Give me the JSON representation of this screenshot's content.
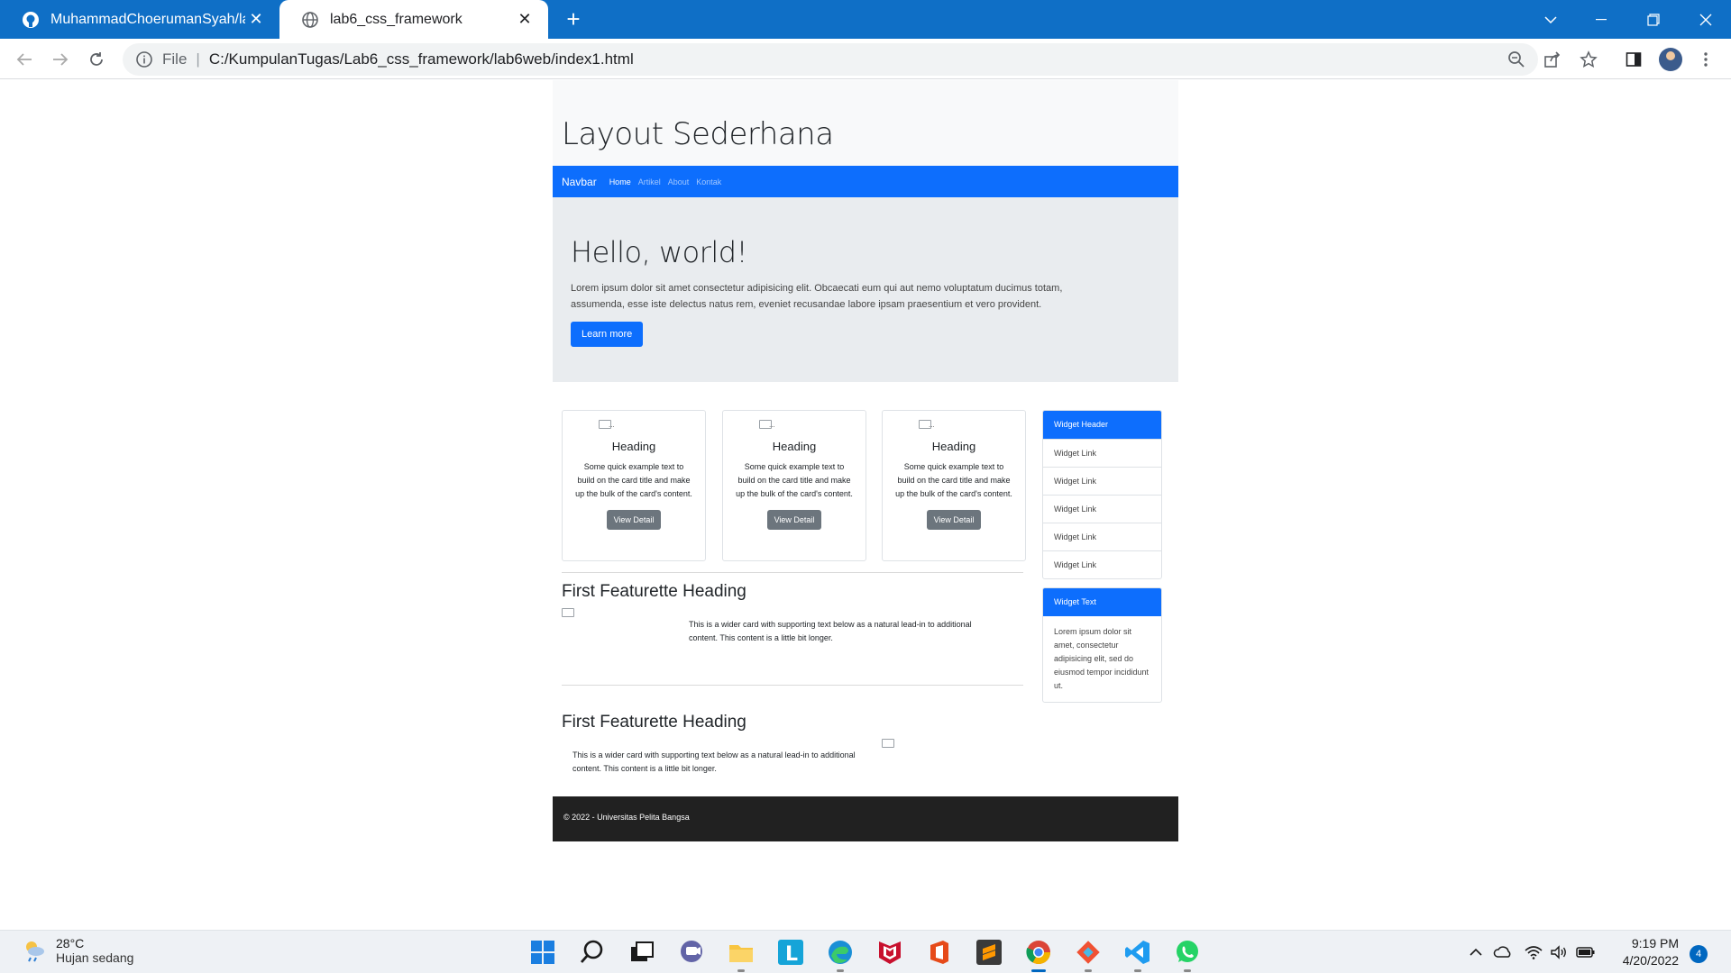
{
  "browser": {
    "tabs": [
      {
        "title": "MuhammadChoerumanSyah/lab",
        "icon": "github-icon",
        "active": false
      },
      {
        "title": "lab6_css_framework",
        "icon": "globe-icon",
        "active": true
      }
    ],
    "address": {
      "scheme_label": "File",
      "url": "C:/KumpulanTugas/Lab6_css_framework/lab6web/index1.html"
    },
    "accent_color": "#0f6fc6"
  },
  "page": {
    "header_title": "Layout Sederhana",
    "navbar": {
      "brand": "Navbar",
      "links": [
        "Home",
        "Artikel",
        "About",
        "Kontak"
      ],
      "active_link": "Home",
      "color": "#0d6efd"
    },
    "hero": {
      "title": "Hello, world!",
      "text": "Lorem ipsum dolor sit amet consectetur adipisicing elit. Obcaecati eum qui aut nemo voluptatum ducimus totam, assumenda, esse iste delectus natus rem, eveniet recusandae labore ipsam praesentium et vero provident.",
      "button": "Learn more"
    },
    "cards": [
      {
        "heading": "Heading",
        "text": "Some quick example text to build on the card title and make up the bulk of the card's content.",
        "button": "View Detail"
      },
      {
        "heading": "Heading",
        "text": "Some quick example text to build on the card title and make up the bulk of the card's content.",
        "button": "View Detail"
      },
      {
        "heading": "Heading",
        "text": "Some quick example text to build on the card title and make up the bulk of the card's content.",
        "button": "View Detail"
      }
    ],
    "featurettes": [
      {
        "heading": "First Featurette Heading",
        "text": "This is a wider card with supporting text below as a natural lead-in to additional content. This content is a little bit longer."
      },
      {
        "heading": "First Featurette Heading",
        "text": "This is a wider card with supporting text below as a natural lead-in to additional content. This content is a little bit longer."
      }
    ],
    "widget_links": {
      "header": "Widget Header",
      "links": [
        "Widget Link",
        "Widget Link",
        "Widget Link",
        "Widget Link",
        "Widget Link"
      ]
    },
    "widget_text": {
      "header": "Widget Text",
      "text": "Lorem ipsum dolor sit amet, consectetur adipisicing elit, sed do eiusmod tempor incididunt ut."
    },
    "footer": "© 2022 - Universitas Pelita Bangsa"
  },
  "taskbar": {
    "weather": {
      "temp": "28°C",
      "desc": "Hujan sedang"
    },
    "apps": [
      "windows-start",
      "search",
      "task-view",
      "teams-chat",
      "file-explorer",
      "l-app",
      "edge",
      "mcafee",
      "office",
      "sublime-text",
      "chrome",
      "git-app",
      "vscode",
      "whatsapp"
    ],
    "time": "9:19 PM",
    "date": "4/20/2022",
    "notification_count": "4"
  }
}
